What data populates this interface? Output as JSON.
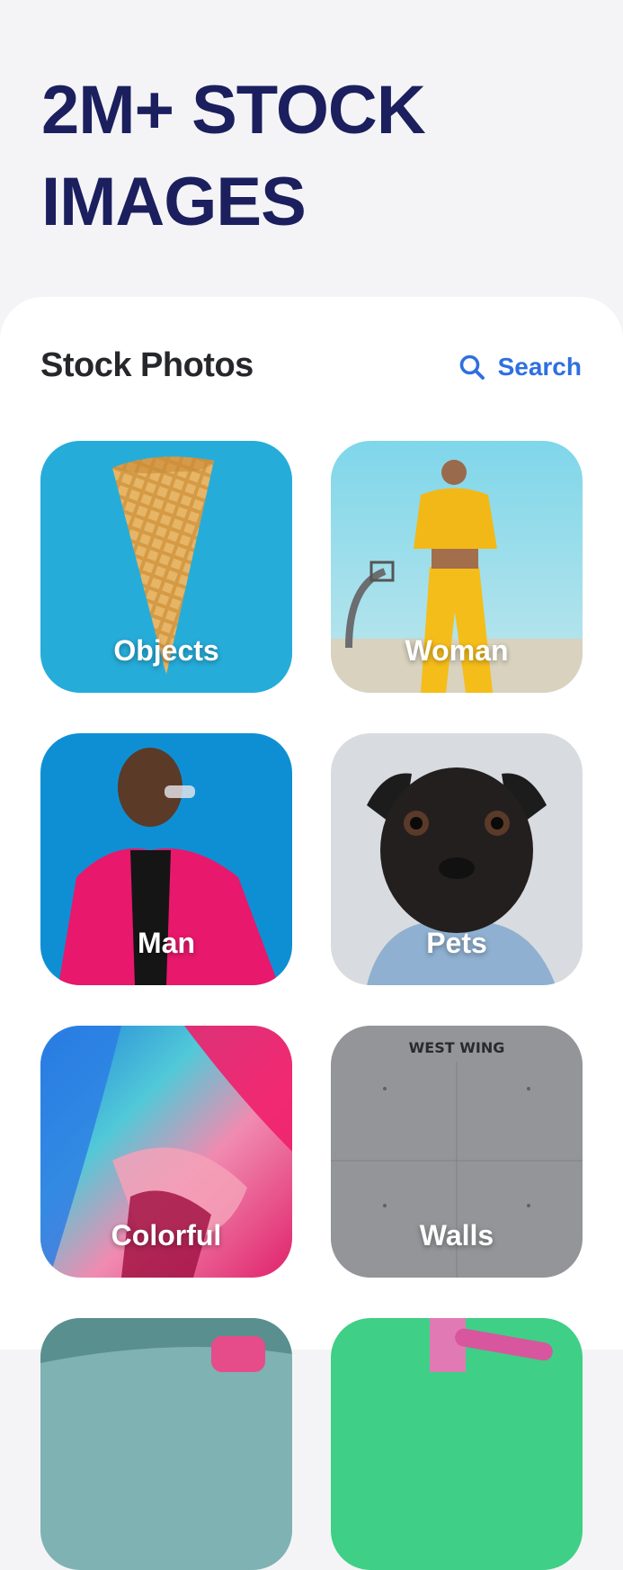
{
  "hero": {
    "line1": "2M+ STOCK",
    "line2": "IMAGES"
  },
  "section": {
    "title": "Stock Photos",
    "search_label": "Search",
    "search_icon": "search-icon"
  },
  "categories": [
    {
      "label": "Objects"
    },
    {
      "label": "Woman"
    },
    {
      "label": "Man"
    },
    {
      "label": "Pets"
    },
    {
      "label": "Colorful"
    },
    {
      "label": "Walls"
    },
    {
      "label": ""
    },
    {
      "label": ""
    }
  ],
  "walls_sign": "WEST WING",
  "colors": {
    "heading": "#1b1f5e",
    "accent": "#2f6fe0",
    "background": "#f4f4f6",
    "sheet": "#ffffff"
  }
}
